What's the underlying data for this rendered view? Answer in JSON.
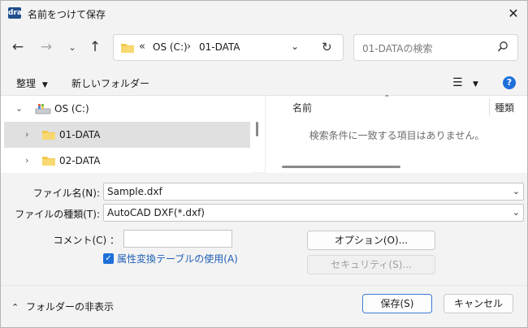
{
  "window": {
    "title": "名前をつけて保存",
    "app_icon_text": "dra"
  },
  "address": {
    "chevron": "«",
    "segment1": "OS (C:)",
    "separator": "›",
    "segment2": "01-DATA"
  },
  "search": {
    "placeholder": "01-DATAの検索"
  },
  "toolbar": {
    "organize": "整理",
    "new_folder": "新しいフォルダー"
  },
  "tree": {
    "drive": "OS (C:)",
    "items": [
      {
        "label": "01-DATA",
        "selected": true
      },
      {
        "label": "02-DATA",
        "selected": false
      }
    ]
  },
  "list": {
    "col_name": "名前",
    "col_type": "種類",
    "empty_message": "検索条件に一致する項目はありません。"
  },
  "form": {
    "filename_label": "ファイル名(N):",
    "filename_value": "Sample.dxf",
    "filetype_label": "ファイルの種類(T):",
    "filetype_value": "AutoCAD DXF(*.dxf)",
    "comment_label": "コメント(C) ：",
    "checkbox_label": "属性変換テーブルの使用(A)",
    "checkbox_checked": true
  },
  "buttons": {
    "options": "オプション(O)...",
    "security": "セキュリティ(S)...",
    "save": "保存(S)",
    "cancel": "キャンセル",
    "hide_folders": "フォルダーの非表示"
  },
  "colors": {
    "accent": "#1e6fd9",
    "folder": "#f2c94c"
  }
}
